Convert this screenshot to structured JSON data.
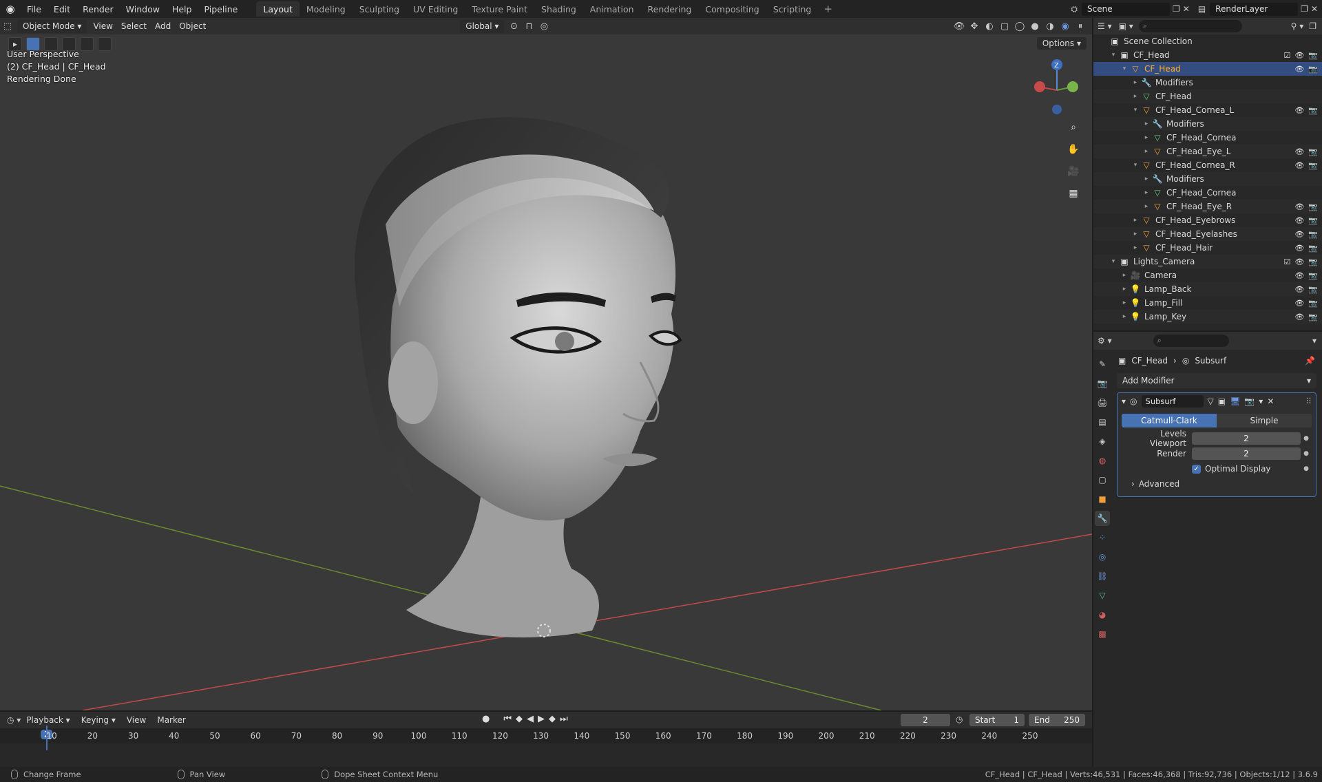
{
  "menubar": {
    "items": [
      "File",
      "Edit",
      "Render",
      "Window",
      "Help",
      "Pipeline"
    ],
    "workspaces": [
      "Layout",
      "Modeling",
      "Sculpting",
      "UV Editing",
      "Texture Paint",
      "Shading",
      "Animation",
      "Rendering",
      "Compositing",
      "Scripting"
    ],
    "active_workspace": "Layout",
    "scene": "Scene",
    "view_layer": "RenderLayer"
  },
  "viewport": {
    "mode": "Object Mode",
    "menus": [
      "View",
      "Select",
      "Add",
      "Object"
    ],
    "orientation": "Global",
    "options_label": "Options",
    "info": {
      "line1": "User Perspective",
      "line2": "(2) CF_Head | CF_Head",
      "line3": "Rendering Done"
    },
    "gizmo": {
      "z": "Z"
    }
  },
  "outliner": {
    "root": "Scene Collection",
    "rows": [
      {
        "label": "CF_Head",
        "kind": "collection"
      },
      {
        "label": "CF_Head",
        "kind": "object"
      },
      {
        "label": "Modifiers",
        "kind": "modifiers"
      },
      {
        "label": "CF_Head",
        "kind": "mesh"
      },
      {
        "label": "CF_Head_Cornea_L",
        "kind": "object"
      },
      {
        "label": "Modifiers",
        "kind": "modifiers"
      },
      {
        "label": "CF_Head_Cornea",
        "kind": "mesh"
      },
      {
        "label": "CF_Head_Eye_L",
        "kind": "object"
      },
      {
        "label": "CF_Head_Cornea_R",
        "kind": "object"
      },
      {
        "label": "Modifiers",
        "kind": "modifiers"
      },
      {
        "label": "CF_Head_Cornea",
        "kind": "mesh"
      },
      {
        "label": "CF_Head_Eye_R",
        "kind": "object"
      },
      {
        "label": "CF_Head_Eyebrows",
        "kind": "object"
      },
      {
        "label": "CF_Head_Eyelashes",
        "kind": "object"
      },
      {
        "label": "CF_Head_Hair",
        "kind": "object"
      },
      {
        "label": "Lights_Camera",
        "kind": "collection"
      },
      {
        "label": "Camera",
        "kind": "camera"
      },
      {
        "label": "Lamp_Back",
        "kind": "light"
      },
      {
        "label": "Lamp_Fill",
        "kind": "light"
      },
      {
        "label": "Lamp_Key",
        "kind": "light"
      }
    ]
  },
  "properties": {
    "breadcrumb_object": "CF_Head",
    "breadcrumb_modifier": "Subsurf",
    "add_modifier": "Add Modifier",
    "modifier": {
      "name": "Subsurf",
      "type_on": "Catmull-Clark",
      "type_off": "Simple",
      "levels_viewport_label": "Levels Viewport",
      "levels_viewport": "2",
      "render_label": "Render",
      "render": "2",
      "optimal_display": "Optimal Display",
      "advanced": "Advanced"
    }
  },
  "timeline": {
    "menus": [
      "Playback",
      "Keying",
      "View",
      "Marker"
    ],
    "current_frame": "2",
    "start_label": "Start",
    "start": "1",
    "end_label": "End",
    "end": "250",
    "ticks": [
      "10",
      "20",
      "30",
      "40",
      "50",
      "60",
      "70",
      "80",
      "90",
      "100",
      "110",
      "120",
      "130",
      "140",
      "150",
      "160",
      "170",
      "180",
      "190",
      "200",
      "210",
      "220",
      "230",
      "240",
      "250"
    ]
  },
  "statusbar": {
    "hint1": "Change Frame",
    "hint2": "Pan View",
    "hint3": "Dope Sheet Context Menu",
    "stats": "CF_Head | CF_Head | Verts:46,531 | Faces:46,368 | Tris:92,736 | Objects:1/12 | 3.6.9"
  },
  "colors": {
    "accent": "#4772b3",
    "selected_text": "#ffaf29",
    "x_axis": "#c14a4a",
    "y_axis": "#6a8a2f"
  }
}
